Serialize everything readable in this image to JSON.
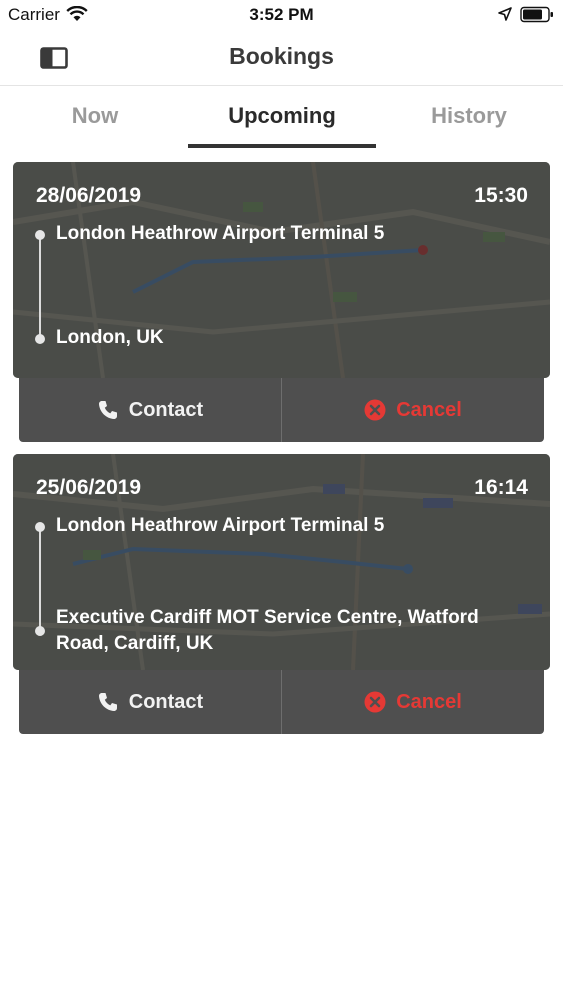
{
  "status_bar": {
    "carrier": "Carrier",
    "time": "3:52 PM"
  },
  "nav": {
    "title": "Bookings",
    "sidebar_icon": "sidebar-toggle-icon"
  },
  "tabs": [
    {
      "label": "Now",
      "active": false
    },
    {
      "label": "Upcoming",
      "active": true
    },
    {
      "label": "History",
      "active": false
    }
  ],
  "bookings": [
    {
      "date": "28/06/2019",
      "time": "15:30",
      "pickup": "London Heathrow Airport Terminal 5",
      "dropoff": "London, UK",
      "contact_label": "Contact",
      "cancel_label": "Cancel"
    },
    {
      "date": "25/06/2019",
      "time": "16:14",
      "pickup": "London Heathrow Airport Terminal 5",
      "dropoff": "Executive Cardiff MOT Service Centre, Watford Road, Cardiff, UK",
      "contact_label": "Contact",
      "cancel_label": "Cancel"
    }
  ],
  "colors": {
    "accent_dark": "#333333",
    "cancel_red": "#e53935",
    "inactive_tab": "#9a9a9a"
  }
}
